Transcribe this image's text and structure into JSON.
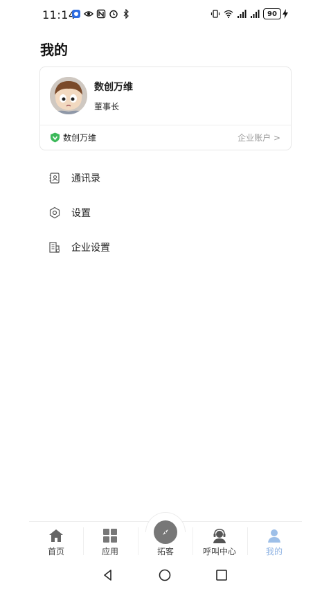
{
  "status_bar": {
    "time": "11:14",
    "battery": "90"
  },
  "page": {
    "title": "我的"
  },
  "profile": {
    "name": "数创万维",
    "role": "董事长",
    "company": "数创万维",
    "account_link": "企业账户 >"
  },
  "menu": {
    "items": [
      {
        "label": "通讯录",
        "icon": "contacts-icon"
      },
      {
        "label": "设置",
        "icon": "gear-icon"
      },
      {
        "label": "企业设置",
        "icon": "building-settings-icon"
      }
    ]
  },
  "bottom_nav": {
    "items": [
      {
        "label": "首页",
        "icon": "home-icon"
      },
      {
        "label": "应用",
        "icon": "apps-grid-icon"
      },
      {
        "label": "拓客",
        "icon": "compass-icon"
      },
      {
        "label": "呼叫中心",
        "icon": "headset-icon"
      },
      {
        "label": "我的",
        "icon": "user-icon"
      }
    ],
    "active": "我的"
  },
  "colors": {
    "active_tab": "#8fb3e3",
    "verified_badge": "#3cb95a",
    "muted_text": "#9a9a9a"
  }
}
